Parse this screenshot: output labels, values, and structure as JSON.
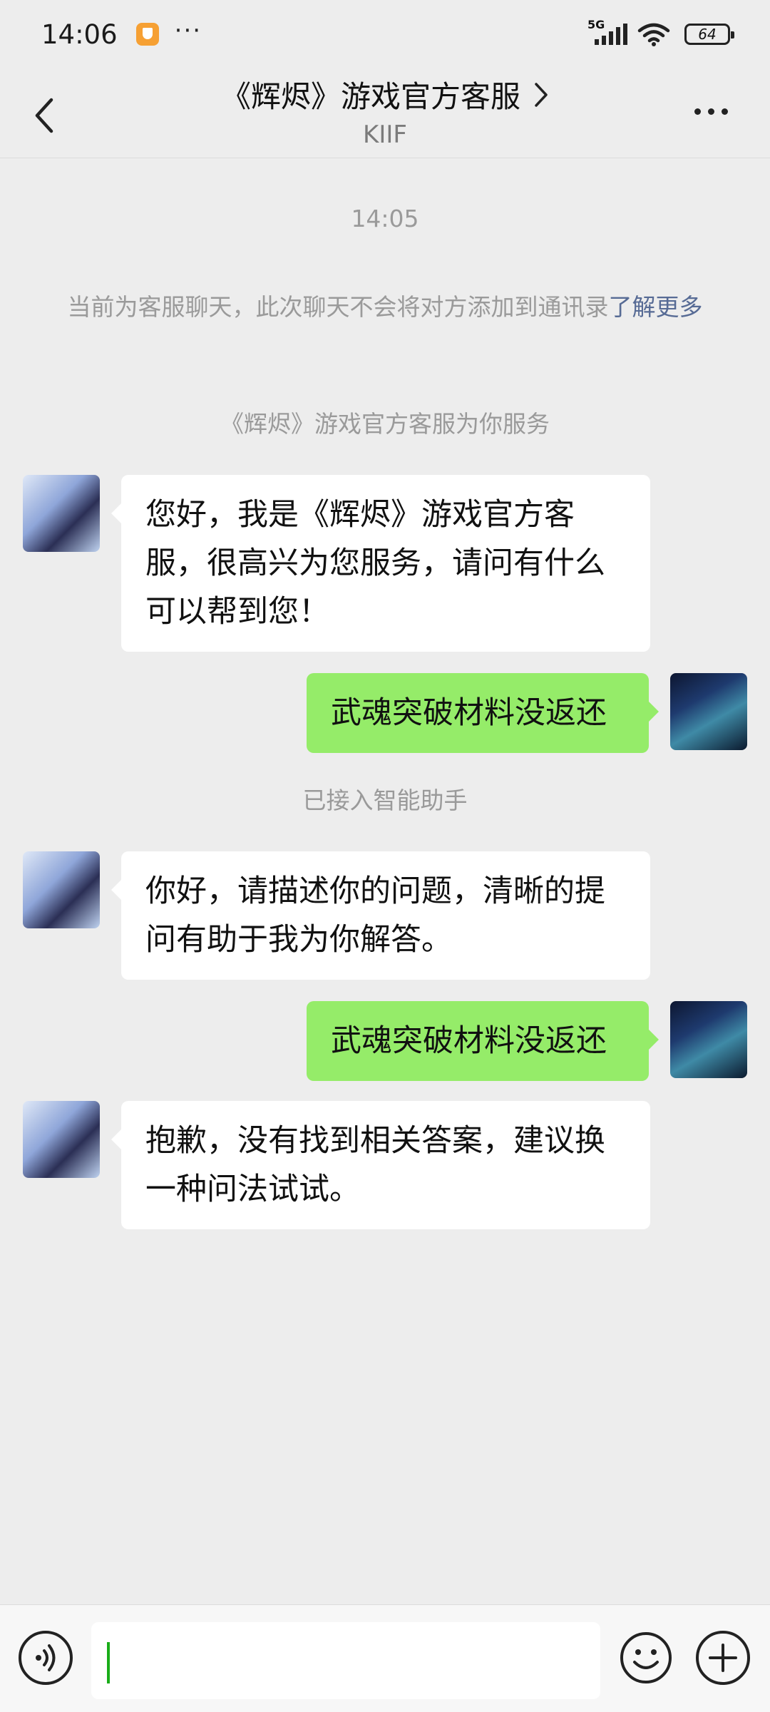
{
  "status_bar": {
    "time": "14:06",
    "overflow": "···",
    "network": "5G",
    "battery": "64"
  },
  "header": {
    "title": "《辉烬》游戏官方客服",
    "subtitle": "KIIF"
  },
  "messages": {
    "timestamp": "14:05",
    "notice_text": "当前为客服聊天，此次聊天不会将对方添加到通讯录",
    "notice_link": "了解更多",
    "service_banner": "《辉烬》游戏官方客服为你服务",
    "m1": "您好，我是《辉烬》游戏官方客服，很高兴为您服务，请问有什么可以帮到您！",
    "m2": "武魂突破材料没返还",
    "assistant_banner": "已接入智能助手",
    "m3": "你好，请描述你的问题，清晰的提问有助于我为你解答。",
    "m4": "武魂突破材料没返还",
    "m5": "抱歉，没有找到相关答案，建议换一种问法试试。"
  },
  "input": {
    "value": "",
    "placeholder": ""
  },
  "colors": {
    "background": "#ededed",
    "bubble_sent": "#95ec69",
    "bubble_received": "#ffffff",
    "link": "#576b95",
    "cursor": "#1aad19"
  },
  "icons": {
    "back": "chevron-left-icon",
    "title_chevron": "chevron-right-icon",
    "more": "more-icon",
    "voice": "voice-icon",
    "emoji": "emoji-icon",
    "plus": "plus-icon"
  }
}
